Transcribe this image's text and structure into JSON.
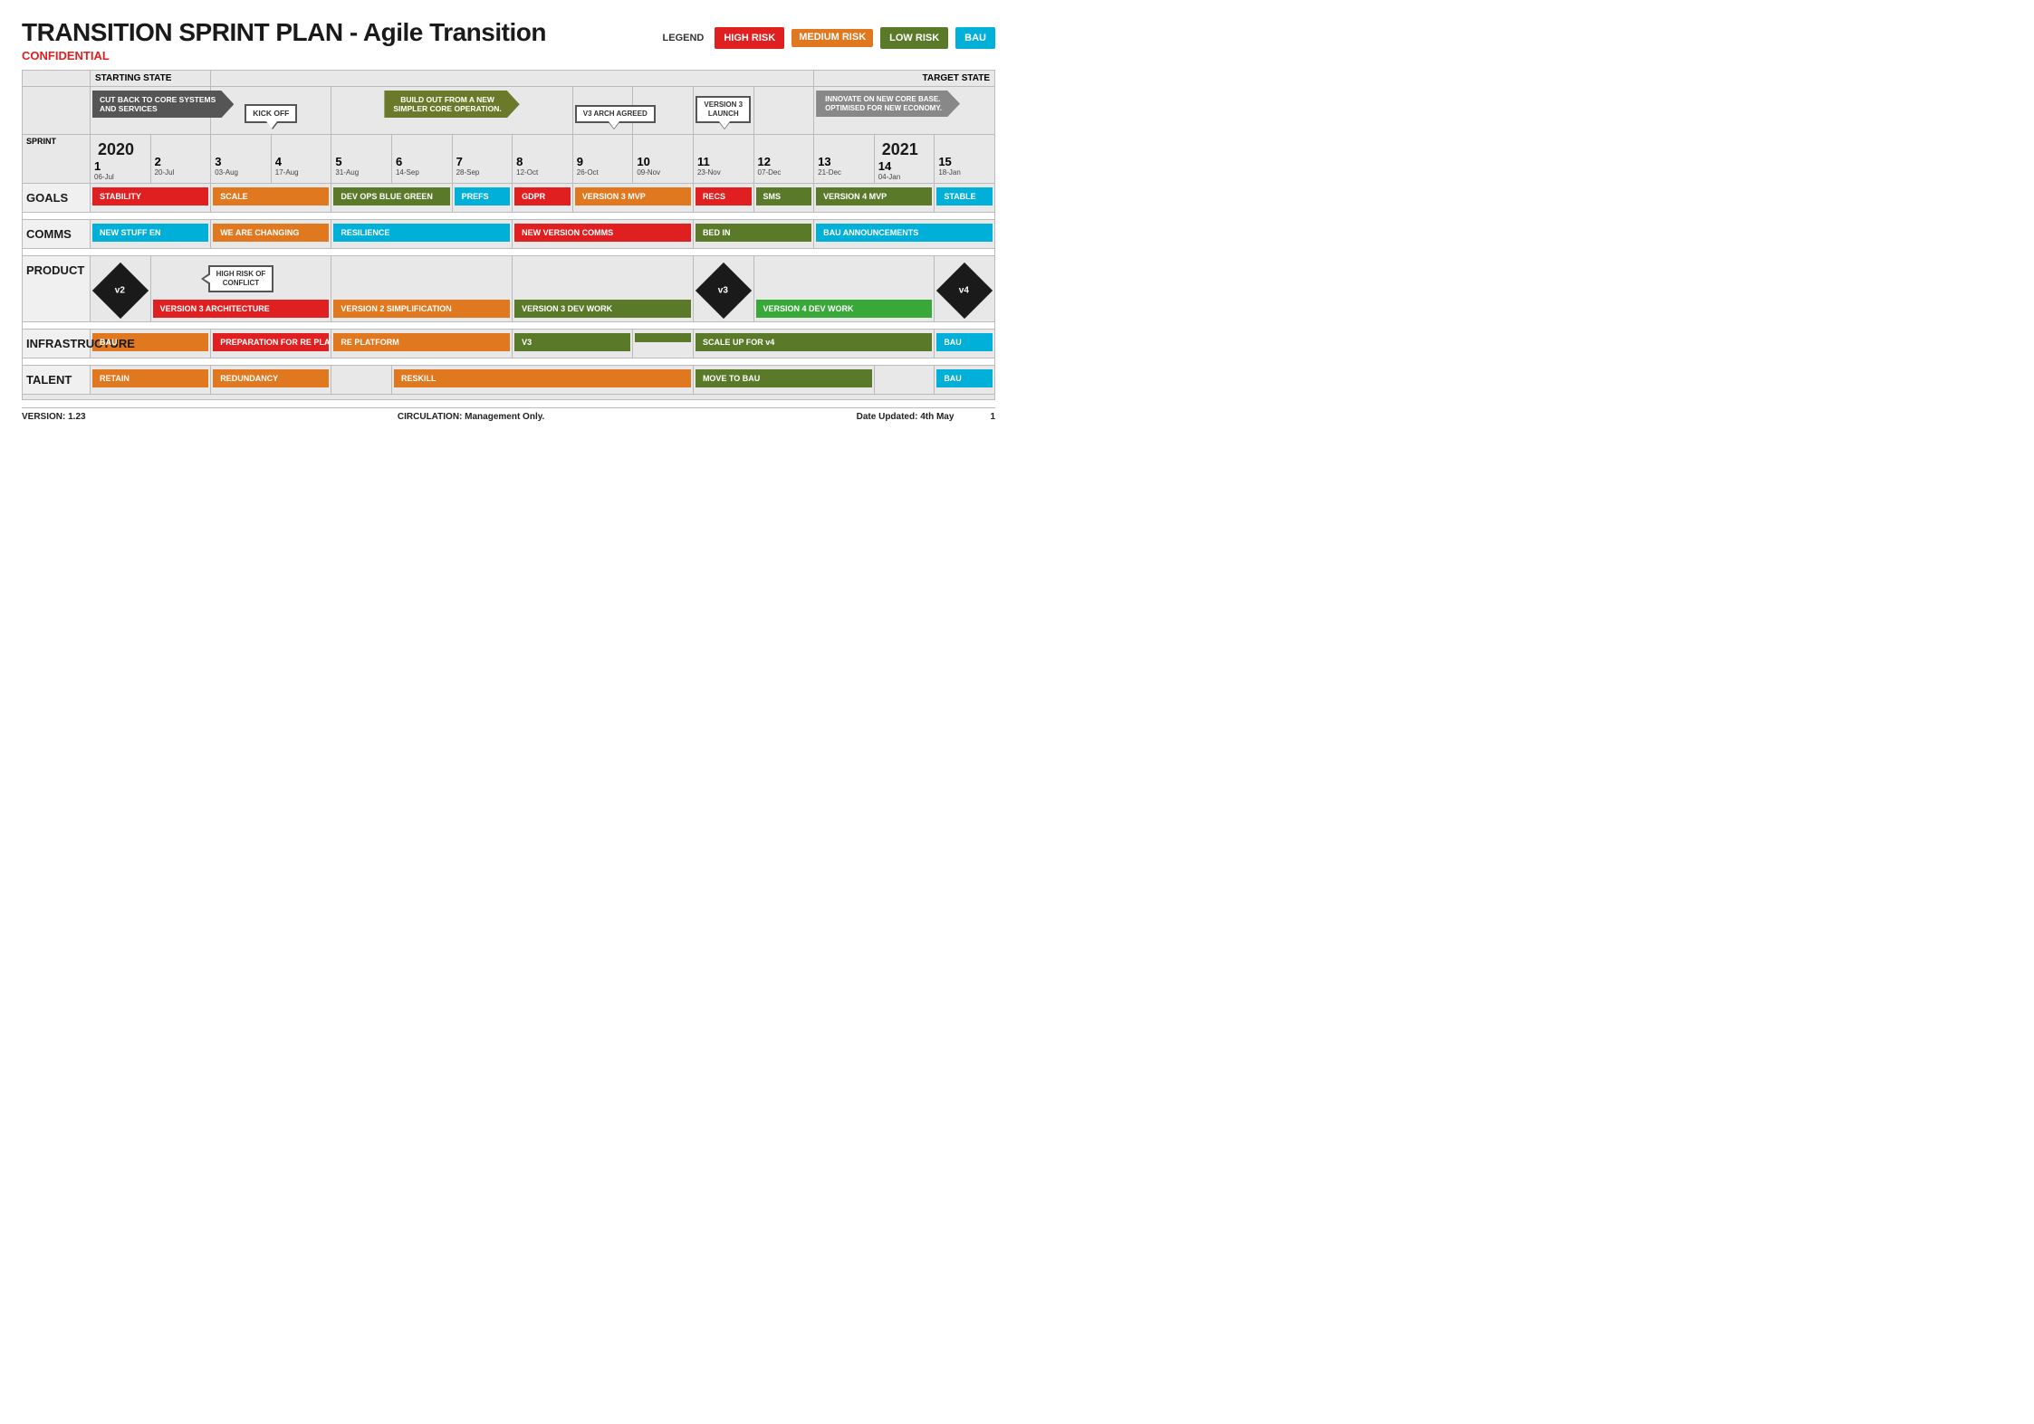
{
  "header": {
    "title": "TRANSITION SPRINT PLAN - Agile Transition",
    "confidential": "CONFIDENTIAL",
    "legend_label": "LEGEND",
    "legend_items": [
      {
        "label": "HIGH RISK",
        "class": "badge-high"
      },
      {
        "label": "MEDIUM RISK",
        "class": "badge-medium"
      },
      {
        "label": "LOW RISK",
        "class": "badge-low"
      },
      {
        "label": "BAU",
        "class": "badge-bau"
      }
    ]
  },
  "starting_state": "STARTING STATE",
  "target_state": "TARGET STATE",
  "phase_banners": [
    {
      "text": "CUT BACK TO CORE SYSTEMS AND SERVICES",
      "class": "as-dark"
    },
    {
      "text": "BUILD OUT FROM A NEW SIMPLER CORE OPERATION.",
      "class": "as-olive"
    },
    {
      "text": "INNOVATE ON NEW CORE BASE. OPTIMISED FOR NEW ECONOMY.",
      "class": "as-gray"
    }
  ],
  "callouts": [
    {
      "text": "KICK OFF",
      "type": "down"
    },
    {
      "text": "V3 ARCH AGREED",
      "type": "down"
    },
    {
      "text": "VERSION 3\nLAUNCH",
      "type": "down"
    }
  ],
  "year_2020": "2020",
  "year_2021": "2021",
  "sprints": [
    {
      "num": "1",
      "date": "06-Jul"
    },
    {
      "num": "2",
      "date": "20-Jul"
    },
    {
      "num": "3",
      "date": "03-Aug"
    },
    {
      "num": "4",
      "date": "17-Aug"
    },
    {
      "num": "5",
      "date": "31-Aug"
    },
    {
      "num": "6",
      "date": "14-Sep"
    },
    {
      "num": "7",
      "date": "28-Sep"
    },
    {
      "num": "8",
      "date": "12-Oct"
    },
    {
      "num": "9",
      "date": "26-Oct"
    },
    {
      "num": "10",
      "date": "09-Nov"
    },
    {
      "num": "11",
      "date": "23-Nov"
    },
    {
      "num": "12",
      "date": "07-Dec"
    },
    {
      "num": "13",
      "date": "21-Dec"
    },
    {
      "num": "14",
      "date": "04-Jan"
    },
    {
      "num": "15",
      "date": "18-Jan"
    }
  ],
  "sections": {
    "goals": {
      "label": "GOALS",
      "bars": [
        {
          "text": "STABILITY",
          "start": 1,
          "span": 2,
          "class": "hbar-red"
        },
        {
          "text": "SCALE",
          "start": 3,
          "span": 2,
          "class": "hbar-orange"
        },
        {
          "text": "DEV OPS BLUE GREEN",
          "start": 5,
          "span": 2,
          "class": "hbar-olive"
        },
        {
          "text": "PREFS",
          "start": 7,
          "span": 1,
          "class": "hbar-cyan"
        },
        {
          "text": "GDPR",
          "start": 8,
          "span": 1,
          "class": "hbar-red"
        },
        {
          "text": "VERSION 3 MVP",
          "start": 9,
          "span": 2,
          "class": "hbar-orange"
        },
        {
          "text": "RECS",
          "start": 11,
          "span": 1,
          "class": "hbar-red"
        },
        {
          "text": "SMS",
          "start": 12,
          "span": 1,
          "class": "hbar-olive"
        },
        {
          "text": "VERSION 4 MVP",
          "start": 13,
          "span": 2,
          "class": "hbar-olive"
        },
        {
          "text": "STABLE",
          "start": 15,
          "span": 1,
          "class": "hbar-cyan"
        }
      ]
    },
    "comms": {
      "label": "COMMS",
      "bars": [
        {
          "text": "NEW STUFF EN",
          "start": 1,
          "span": 2,
          "class": "hbar-cyan"
        },
        {
          "text": "WE ARE CHANGING",
          "start": 3,
          "span": 2,
          "class": "hbar-orange"
        },
        {
          "text": "RESILIENCE",
          "start": 5,
          "span": 3,
          "class": "hbar-cyan"
        },
        {
          "text": "NEW VERSION COMMS",
          "start": 8,
          "span": 3,
          "class": "hbar-red"
        },
        {
          "text": "BED IN",
          "start": 11,
          "span": 2,
          "class": "hbar-olive"
        },
        {
          "text": "BAU ANNOUNCEMENTS",
          "start": 13,
          "span": 3,
          "class": "hbar-cyan"
        }
      ]
    },
    "product": {
      "label": "PRODUCT",
      "bars": [
        {
          "text": "VERSION 3 ARCHITECTURE",
          "start": 2,
          "span": 3,
          "class": "hbar-red"
        },
        {
          "text": "VERSION 2 SIMPLIFICATION",
          "start": 5,
          "span": 3,
          "class": "hbar-orange"
        },
        {
          "text": "VERSION 3 DEV WORK",
          "start": 8,
          "span": 3,
          "class": "hbar-olive"
        },
        {
          "text": "VERSION 4 DEV WORK",
          "start": 11,
          "span": 4,
          "class": "hbar-green"
        }
      ],
      "diamonds": [
        {
          "label": "v2",
          "col": 1
        },
        {
          "label": "v3",
          "col": 10
        },
        {
          "label": "v4",
          "col": 14
        }
      ],
      "conflict_callout": {
        "text": "HIGH RISK OF\nCONFLICT",
        "col": 4
      }
    },
    "infrastructure": {
      "label": "INFRASTRUCTURE",
      "bars": [
        {
          "text": "BAU",
          "start": 1,
          "span": 2,
          "class": "hbar-orange"
        },
        {
          "text": "PREPARATION FOR RE PLATFORM",
          "start": 3,
          "span": 2,
          "class": "hbar-red"
        },
        {
          "text": "RE PLATFORM",
          "start": 5,
          "span": 3,
          "class": "hbar-orange"
        },
        {
          "text": "V3",
          "start": 8,
          "span": 2,
          "class": "hbar-olive"
        },
        {
          "text": "SCALE UP FOR v4",
          "start": 11,
          "span": 4,
          "class": "hbar-olive"
        },
        {
          "text": "BAU",
          "start": 15,
          "span": 1,
          "class": "hbar-cyan"
        }
      ]
    },
    "talent": {
      "label": "TALENT",
      "bars": [
        {
          "text": "RETAIN",
          "start": 1,
          "span": 2,
          "class": "hbar-orange"
        },
        {
          "text": "REDUNDANCY",
          "start": 3,
          "span": 2,
          "class": "hbar-orange"
        },
        {
          "text": "RESKILL",
          "start": 6,
          "span": 5,
          "class": "hbar-orange"
        },
        {
          "text": "MOVE TO BAU",
          "start": 11,
          "span": 3,
          "class": "hbar-olive"
        },
        {
          "text": "BAU",
          "start": 15,
          "span": 1,
          "class": "hbar-cyan"
        }
      ]
    }
  },
  "footer": {
    "version": "VERSION: 1.23",
    "circulation": "CIRCULATION: Management Only.",
    "date_updated": "Date Updated: 4th May",
    "page": "1"
  }
}
